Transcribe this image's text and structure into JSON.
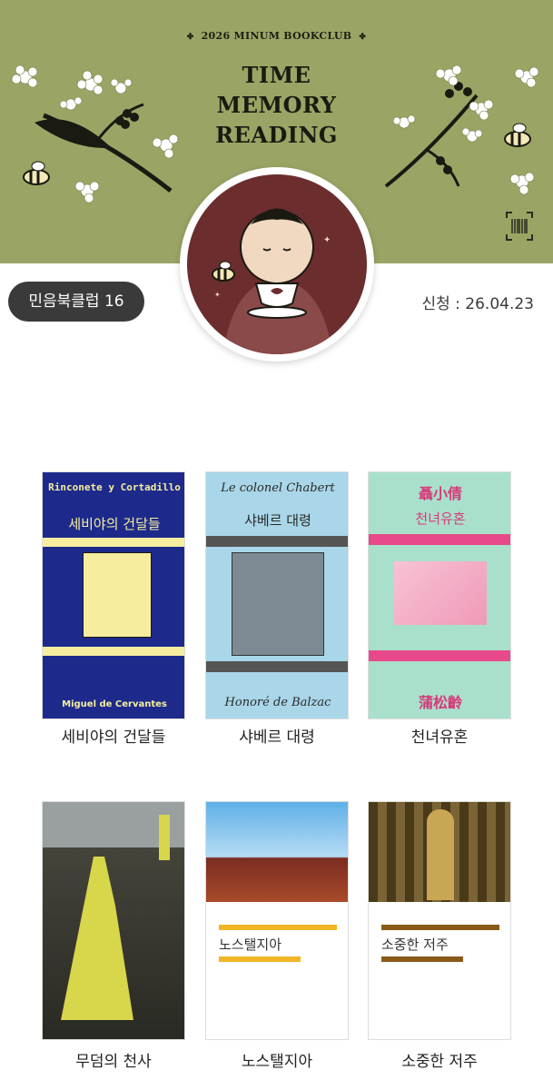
{
  "header": {
    "club_title": "2026 MINUM BOOKCLUB",
    "headline": [
      "TIME",
      "MEMORY",
      "READING"
    ],
    "background_color": "#9aa565"
  },
  "badge": {
    "label": "민음북클럽 16기"
  },
  "signup": {
    "label": "신청 : 26.04.23"
  },
  "books": [
    {
      "title": "세비야의 건달들",
      "cover_title": "세비야의 건달들",
      "cover_top": "Rinconete y Cortadillo",
      "cover_bottom": "Miguel de Cervantes",
      "cover_color": "#1d2a8c"
    },
    {
      "title": "샤베르 대령",
      "cover_title": "샤베르 대령",
      "cover_top": "Le colonel Chabert",
      "cover_bottom": "Honoré de Balzac",
      "cover_color": "#a9d6e8"
    },
    {
      "title": "천녀유혼",
      "cover_title": "천녀유혼",
      "cover_top": "聶小倩",
      "cover_bottom": "蒲松齡",
      "cover_color": "#a9e0cc"
    },
    {
      "title": "무덤의 천사",
      "cover_color": "#3b3b33"
    },
    {
      "title": "노스탤지아",
      "cover_title": "노스탤지아",
      "cover_color": "#ffffff"
    },
    {
      "title": "소중한 저주",
      "cover_title": "소중한 저주",
      "cover_color": "#ffffff"
    }
  ]
}
